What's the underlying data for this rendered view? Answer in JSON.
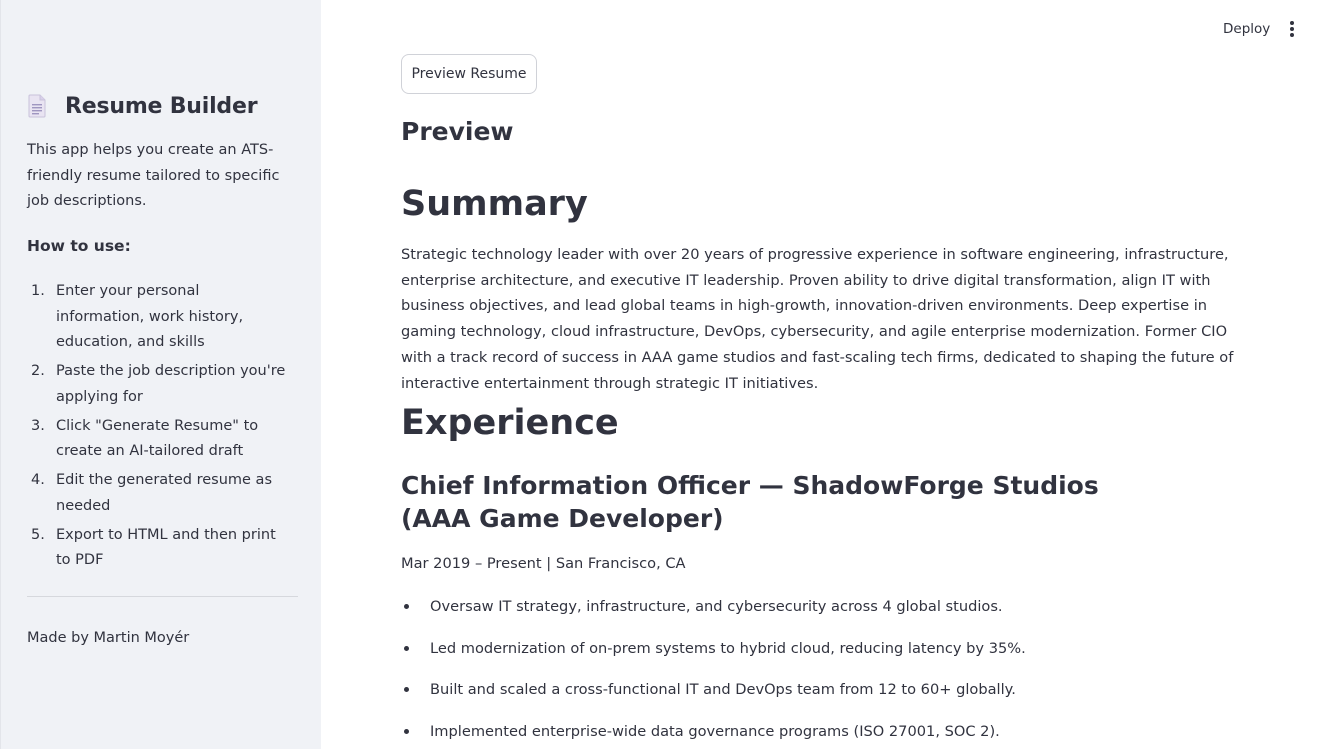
{
  "header": {
    "deploy_label": "Deploy",
    "menu_icon": "more-vertical-icon"
  },
  "sidebar": {
    "icon": "document-icon",
    "title": "Resume Builder",
    "description": "This app helps you create an ATS-friendly resume tailored to specific job descriptions.",
    "how_to_title": "How to use:",
    "steps": [
      {
        "num": "1.",
        "text": "Enter your personal information, work history, education, and skills"
      },
      {
        "num": "2.",
        "text": "Paste the job description you're applying for"
      },
      {
        "num": "3.",
        "text": "Click \"Generate Resume\" to create an AI-tailored draft"
      },
      {
        "num": "4.",
        "text": "Edit the generated resume as needed"
      },
      {
        "num": "5.",
        "text": "Export to HTML and then print to PDF"
      }
    ],
    "footer": "Made by Martin Moyér"
  },
  "main": {
    "preview_button": "Preview Resume",
    "preview_heading": "Preview",
    "summary_heading": "Summary",
    "summary_text": "Strategic technology leader with over 20 years of progressive experience in software engineering, infrastructure, enterprise architecture, and executive IT leadership. Proven ability to drive digital transformation, align IT with business objectives, and lead global teams in high-growth, innovation-driven environments. Deep expertise in gaming technology, cloud infrastructure, DevOps, cybersecurity, and agile enterprise modernization. Former CIO with a track record of success in AAA game studios and fast-scaling tech firms, dedicated to shaping the future of interactive entertainment through strategic IT initiatives.",
    "experience_heading": "Experience",
    "job": {
      "title": "Chief Information Officer — ShadowForge Studios (AAA Game Developer)",
      "meta": "Mar 2019 – Present | San Francisco, CA",
      "bullets": [
        "Oversaw IT strategy, infrastructure, and cybersecurity across 4 global studios.",
        "Led modernization of on-prem systems to hybrid cloud, reducing latency by 35%.",
        "Built and scaled a cross-functional IT and DevOps team from 12 to 60+ globally.",
        "Implemented enterprise-wide data governance programs (ISO 27001, SOC 2)."
      ]
    }
  }
}
